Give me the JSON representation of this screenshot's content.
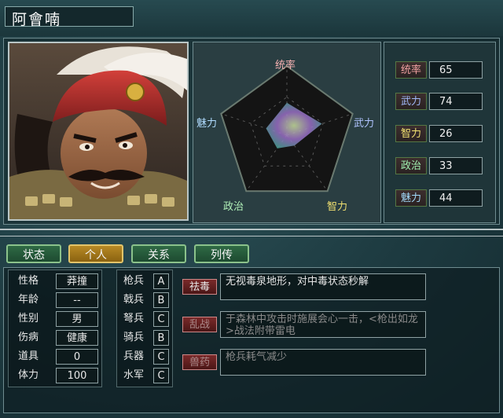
{
  "header": {
    "name": "阿會喃"
  },
  "radar": {
    "labels": {
      "tongshuai": "统率",
      "wuli": "武力",
      "zhili": "智力",
      "zhengzhi": "政治",
      "meili": "魅力"
    },
    "values": [
      65,
      74,
      26,
      33,
      44
    ],
    "max": 100
  },
  "stats": [
    {
      "label": "统率",
      "value": "65",
      "color": "#f0a0a0"
    },
    {
      "label": "武力",
      "value": "74",
      "color": "#a0b8f8"
    },
    {
      "label": "智力",
      "value": "26",
      "color": "#f0e070"
    },
    {
      "label": "政治",
      "value": "33",
      "color": "#a0f0b0"
    },
    {
      "label": "魅力",
      "value": "44",
      "color": "#a0d8f8"
    }
  ],
  "tabs": [
    "状态",
    "个人",
    "关系",
    "列传"
  ],
  "active_tab": "个人",
  "personal": [
    {
      "k": "性格",
      "v": "莽撞"
    },
    {
      "k": "年龄",
      "v": "--"
    },
    {
      "k": "性别",
      "v": "男"
    },
    {
      "k": "伤病",
      "v": "健康"
    },
    {
      "k": "道具",
      "v": "0"
    },
    {
      "k": "体力",
      "v": "100"
    }
  ],
  "troops": [
    {
      "k": "枪兵",
      "v": "A"
    },
    {
      "k": "戟兵",
      "v": "B"
    },
    {
      "k": "弩兵",
      "v": "C"
    },
    {
      "k": "骑兵",
      "v": "B"
    },
    {
      "k": "兵器",
      "v": "C"
    },
    {
      "k": "水军",
      "v": "C"
    }
  ],
  "skills": [
    {
      "name": "祛毒",
      "desc": "无视毒泉地形，对中毒状态秒解",
      "dim": false
    },
    {
      "name": "乱战",
      "desc": "于森林中攻击时施展会心一击，<枪出如龙>战法附带雷电",
      "dim": true
    },
    {
      "name": "兽药",
      "desc": "枪兵耗气减少",
      "dim": true
    }
  ]
}
